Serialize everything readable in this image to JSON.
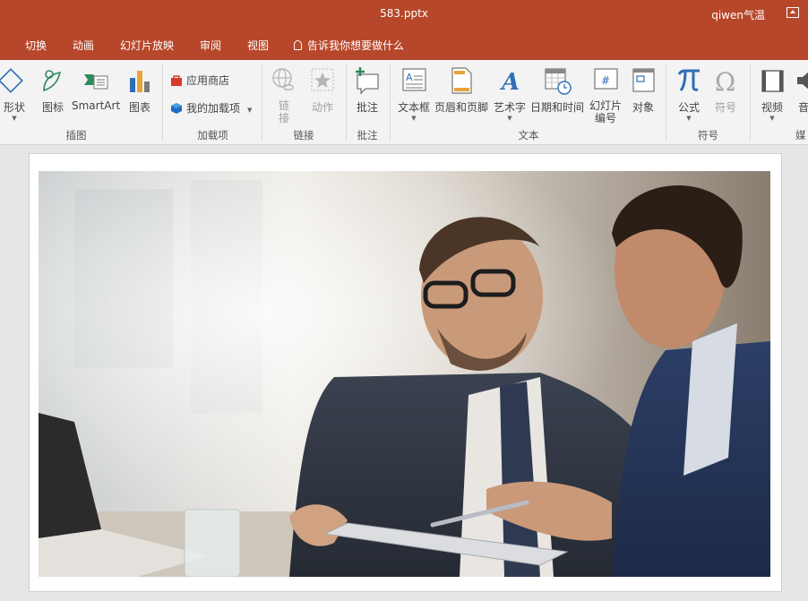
{
  "window": {
    "doc_title": "583.pptx",
    "user": "qiwen气温"
  },
  "tabs": [
    {
      "label": "切换"
    },
    {
      "label": "动画"
    },
    {
      "label": "幻灯片放映"
    },
    {
      "label": "审阅"
    },
    {
      "label": "视图"
    }
  ],
  "tell_me": "告诉我你想要做什么",
  "ribbon": {
    "illustrations": {
      "label": "插图",
      "shapes": "形状",
      "icons": "图标",
      "smartart": "SmartArt",
      "chart": "图表"
    },
    "addins": {
      "label": "加载项",
      "store": "应用商店",
      "my_addins": "我的加载项"
    },
    "links": {
      "label": "链接",
      "link_line1": "链",
      "link_line2": "接",
      "action": "动作"
    },
    "comments": {
      "label": "批注",
      "comment": "批注"
    },
    "text": {
      "label": "文本",
      "textbox": "文本框",
      "header_footer": "页眉和页脚",
      "wordart": "艺术字",
      "datetime": "日期和时间",
      "slide_num_line1": "幻灯片",
      "slide_num_line2": "编号",
      "object": "对象"
    },
    "symbols": {
      "label": "符号",
      "equation": "公式",
      "symbol": "符号"
    },
    "media": {
      "label": "媒",
      "video": "视频",
      "audio": "音"
    }
  },
  "colors": {
    "brand": "#b7472a",
    "ribbon_bg": "#f3f3f3"
  }
}
